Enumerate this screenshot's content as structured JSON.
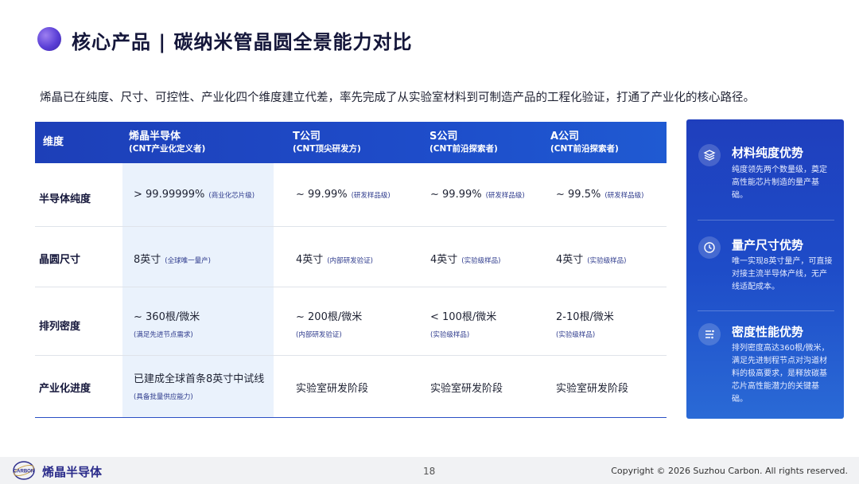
{
  "header": {
    "title": "核心产品 | 碳纳米管晶圆全景能力对比",
    "intro": "烯晶已在纯度、尺寸、可控性、产业化四个维度建立代差，率先完成了从实验室材料到可制造产品的工程化验证，打通了产业化的核心路径。"
  },
  "table": {
    "headers": [
      {
        "title": "维度",
        "subtitle": ""
      },
      {
        "title": "烯晶半导体",
        "subtitle": "(CNT产业化定义者)"
      },
      {
        "title": "T公司",
        "subtitle": "(CNT顶尖研发方)"
      },
      {
        "title": "S公司",
        "subtitle": "(CNT前沿探索者)"
      },
      {
        "title": "A公司",
        "subtitle": "(CNT前沿探索者)"
      }
    ],
    "rows": [
      {
        "dimension": "半导体纯度",
        "cells": [
          {
            "value": "> 99.99999%",
            "note": "(商业化芯片级)"
          },
          {
            "value": "~ 99.99%",
            "note": "(研发样品级)"
          },
          {
            "value": "~ 99.99%",
            "note": "(研发样品级)"
          },
          {
            "value": "~ 99.5%",
            "note": "(研发样品级)"
          }
        ]
      },
      {
        "dimension": "晶圆尺寸",
        "cells": [
          {
            "value": "8英寸",
            "note": "(全球唯一量产)"
          },
          {
            "value": "4英寸",
            "note": "(内部研发验证)"
          },
          {
            "value": "4英寸",
            "note": "(实验级样品)"
          },
          {
            "value": "4英寸",
            "note": "(实验级样品)"
          }
        ]
      },
      {
        "dimension": "排列密度",
        "cells": [
          {
            "value": "~ 360根/微米",
            "note": "(满足先进节点需求)"
          },
          {
            "value": "~ 200根/微米",
            "note": "(内部研发验证)"
          },
          {
            "value": "< 100根/微米",
            "note": "(实验级样品)"
          },
          {
            "value": "2-10根/微米",
            "note": "(实验级样品)"
          }
        ]
      },
      {
        "dimension": "产业化进度",
        "cells": [
          {
            "value": "已建成全球首条8英寸中试线",
            "note": "(具备批量供应能力)"
          },
          {
            "value": "实验室研发阶段",
            "note": ""
          },
          {
            "value": "实验室研发阶段",
            "note": ""
          },
          {
            "value": "实验室研发阶段",
            "note": ""
          }
        ]
      }
    ]
  },
  "advantages": [
    {
      "icon": "layers-icon",
      "title": "材料纯度优势",
      "desc": "纯度领先两个数量级，奠定高性能芯片制造的量产基础。"
    },
    {
      "icon": "clock-icon",
      "title": "量产尺寸优势",
      "desc": "唯一实现8英寸量产，可直接对接主流半导体产线，无产线适配成本。"
    },
    {
      "icon": "density-icon",
      "title": "密度性能优势",
      "desc": "排列密度高达360根/微米，满足先进制程节点对沟道材料的极高要求，是释放碳基芯片高性能潜力的关键基础。"
    }
  ],
  "footer": {
    "logo_text": "CARBON",
    "brand": "烯晶半导体",
    "page_number": "18",
    "copyright": "Copyright © 2026 Suzhou Carbon. All rights reserved."
  },
  "colors": {
    "accent": "#1e4cc8",
    "highlight_column": "#eaf2fc",
    "title": "#14163a"
  }
}
